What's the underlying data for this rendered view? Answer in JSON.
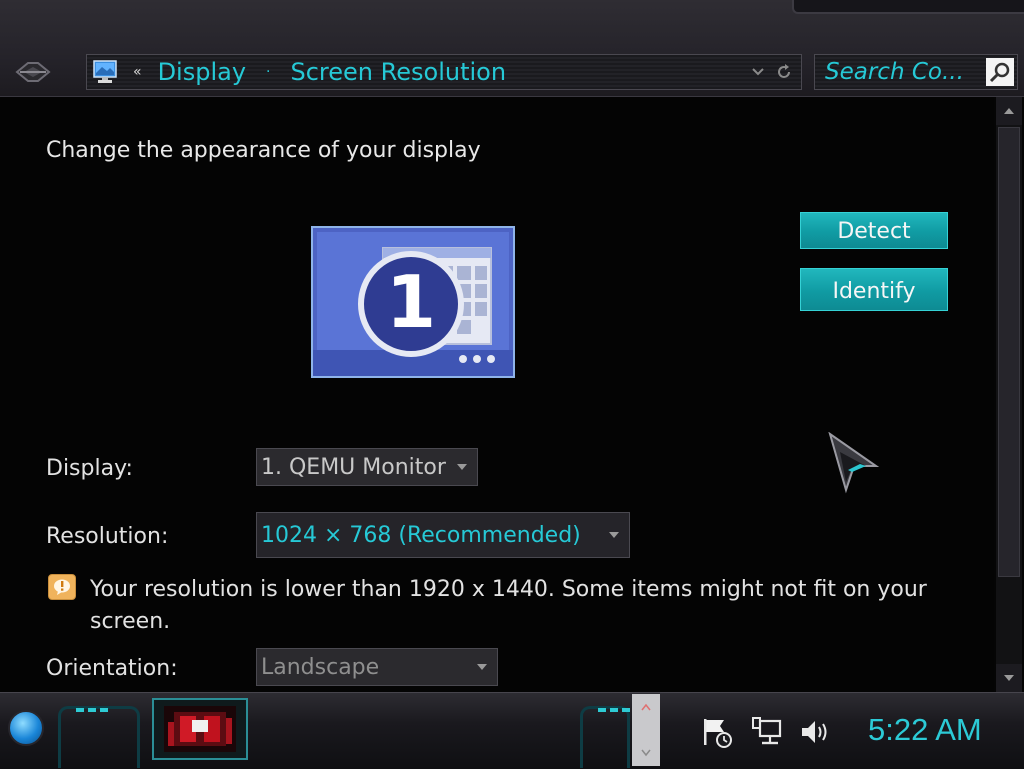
{
  "address_bar": {
    "chevron": "«",
    "crumbs": [
      "Display",
      "Screen Resolution"
    ],
    "separator": "·"
  },
  "search": {
    "placeholder": "Search Co..."
  },
  "main": {
    "heading": "Change the appearance of your display",
    "monitor_number": "1",
    "detect_label": "Detect",
    "identify_label": "Identify",
    "display_label": "Display:",
    "display_value": "1. QEMU Monitor",
    "resolution_label": "Resolution:",
    "resolution_value": "1024 × 768 (Recommended)",
    "warning": "Your resolution is lower than 1920 x 1440. Some items might not fit on your screen.",
    "orientation_label": "Orientation:",
    "orientation_value": "Landscape"
  },
  "taskbar": {
    "clock": "5:22 AM"
  },
  "colors": {
    "accent": "#26c9d6",
    "button": "#13a6ad",
    "warning": "#f0b35c"
  }
}
